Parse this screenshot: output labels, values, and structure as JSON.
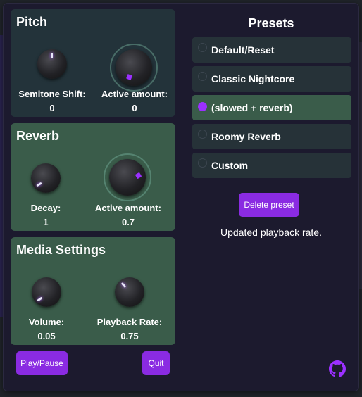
{
  "pitch": {
    "title": "Pitch",
    "semitone_label": "Semitone Shift:",
    "semitone_value": "0",
    "active_label": "Active amount:",
    "active_value": "0"
  },
  "reverb": {
    "title": "Reverb",
    "decay_label": "Decay:",
    "decay_value": "1",
    "active_label": "Active amount:",
    "active_value": "0.7"
  },
  "media": {
    "title": "Media Settings",
    "volume_label": "Volume:",
    "volume_value": "0.05",
    "rate_label": "Playback Rate:",
    "rate_value": "0.75"
  },
  "buttons": {
    "play_pause": "Play/Pause",
    "quit": "Quit",
    "delete_preset": "Delete preset"
  },
  "presets": {
    "title": "Presets",
    "items": [
      {
        "label": "Default/Reset",
        "selected": false
      },
      {
        "label": "Classic Nightcore",
        "selected": false
      },
      {
        "label": "(slowed + reverb)",
        "selected": true
      },
      {
        "label": "Roomy Reverb",
        "selected": false
      },
      {
        "label": "Custom",
        "selected": false
      }
    ]
  },
  "status": "Updated playback rate.",
  "icons": {
    "github": "github-icon"
  },
  "colors": {
    "accent": "#8a2be2",
    "panel_green": "#3a5c4a",
    "panel_dark": "#23333a",
    "popup_bg": "#1c1a2e"
  }
}
